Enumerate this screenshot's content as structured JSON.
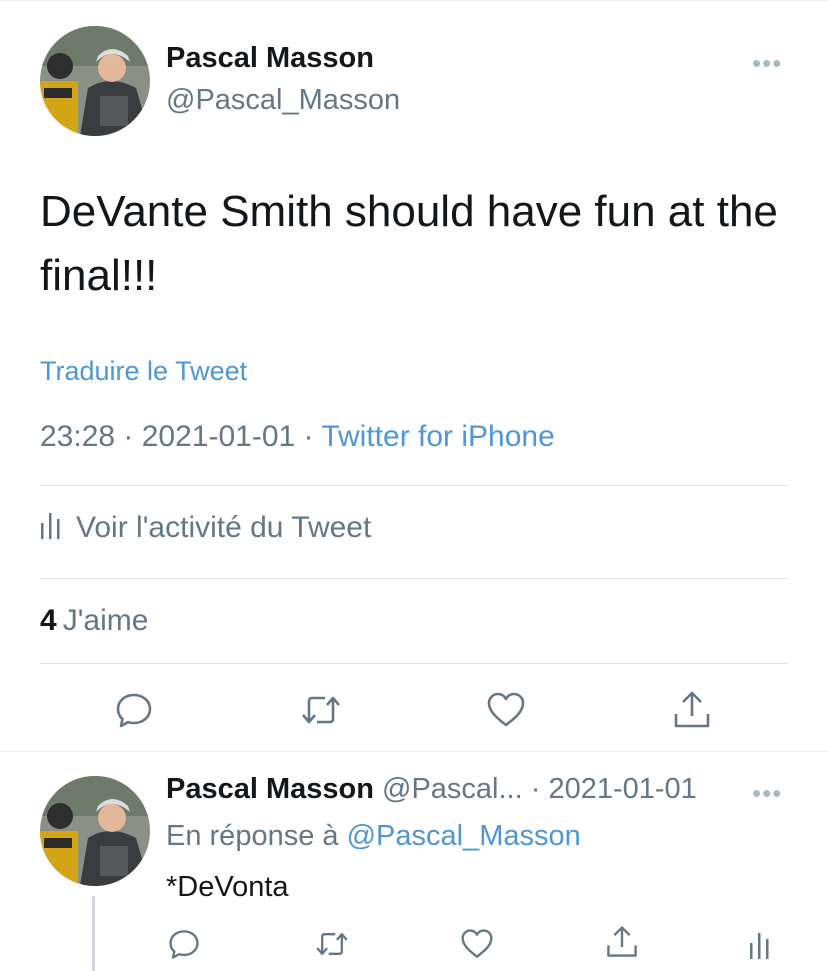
{
  "tweet": {
    "author_name": "Pascal Masson",
    "author_handle": "@Pascal_Masson",
    "more_label": "•••",
    "text": "DeVante Smith should have fun at the final!!!",
    "translate_label": "Traduire le Tweet",
    "time": "23:28",
    "separator": " · ",
    "date": "2021-01-01",
    "source": "Twitter for iPhone",
    "activity_label": "Voir l'activité du Tweet",
    "likes_count": "4",
    "likes_label": "J'aime"
  },
  "icons": {
    "reply": "reply-icon",
    "retweet": "retweet-icon",
    "like": "heart-icon",
    "share": "share-icon",
    "activity": "bar-chart-icon",
    "more": "more-icon"
  },
  "reply": {
    "author_name": "Pascal Masson",
    "author_handle_truncated": "@Pascal...",
    "separator": " · ",
    "date": "2021-01-01",
    "more_label": "•••",
    "in_reply_prefix": "En réponse à",
    "in_reply_mention": "@Pascal_Masson",
    "text": "*DeVonta"
  },
  "colors": {
    "link_blue": "#4f96d3",
    "secondary_text": "#657786",
    "primary_text": "#14171a"
  }
}
